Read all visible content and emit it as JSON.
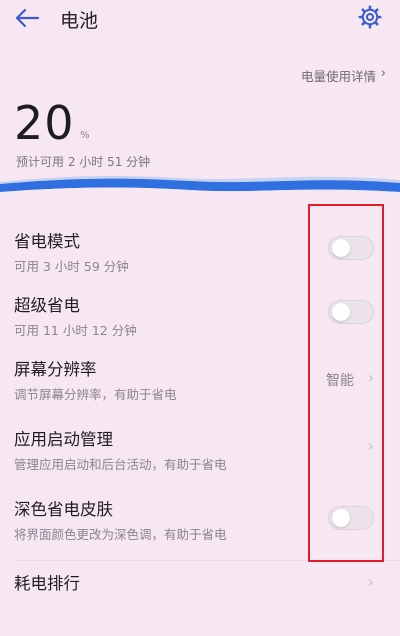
{
  "header": {
    "title": "电池"
  },
  "usage": {
    "link_label": "电量使用详情"
  },
  "battery": {
    "level": "20",
    "unit": "%",
    "remaining": "预计可用 2 小时 51 分钟"
  },
  "rows": [
    {
      "title": "省电模式",
      "subtitle": "可用 3 小时 59 分钟",
      "control": "toggle",
      "on": false
    },
    {
      "title": "超级省电",
      "subtitle": "可用 11 小时 12 分钟",
      "control": "toggle",
      "on": false
    },
    {
      "title": "屏幕分辨率",
      "subtitle": "调节屏幕分辨率，有助于省电",
      "control": "value",
      "value": "智能"
    },
    {
      "title": "应用启动管理",
      "subtitle": "管理应用启动和后台活动，有助于省电",
      "control": "chevron"
    },
    {
      "title": "深色省电皮肤",
      "subtitle": "将界面颜色更改为深色调，有助于省电",
      "control": "toggle",
      "on": false
    },
    {
      "title": "耗电排行",
      "subtitle": "",
      "control": "chevron"
    }
  ],
  "icons": {
    "back": "back-arrow-icon",
    "settings": "gear-icon",
    "chevron": "chevron-right-icon"
  },
  "colors": {
    "accent": "#3a5ccf",
    "wave": "#2f6fe0",
    "highlight_box": "#e01d2b"
  }
}
